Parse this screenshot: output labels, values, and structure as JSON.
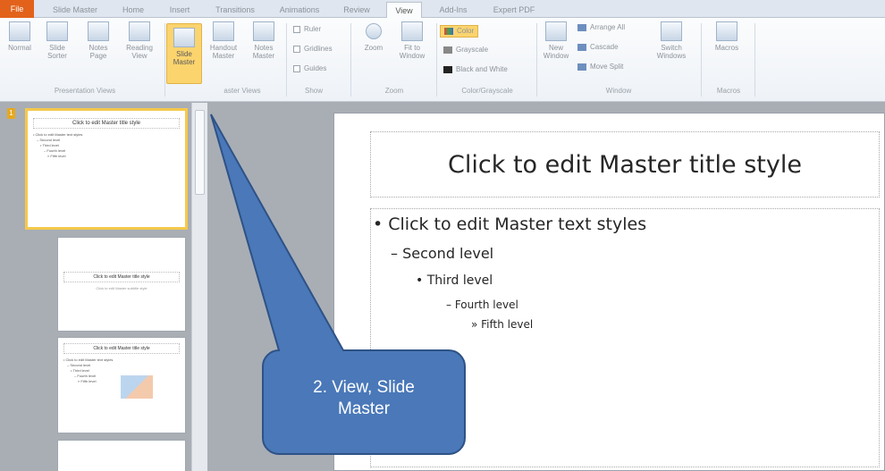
{
  "tabs": [
    "File",
    "Slide Master",
    "Home",
    "Insert",
    "Transitions",
    "Animations",
    "Review",
    "View",
    "Add-Ins",
    "Expert PDF"
  ],
  "active_tab": "View",
  "ribbon": {
    "normal": "Normal",
    "slide_sorter": [
      "Slide",
      "Sorter"
    ],
    "notes_page": [
      "Notes",
      "Page"
    ],
    "reading_view": [
      "Reading",
      "View"
    ],
    "slide_master": [
      "Slide",
      "Master"
    ],
    "handout_master": [
      "Handout",
      "Master"
    ],
    "notes_master": [
      "Notes",
      "Master"
    ],
    "ruler": "Ruler",
    "gridlines": "Gridlines",
    "guides": "Guides",
    "zoom": "Zoom",
    "fit_to_window": [
      "Fit to",
      "Window"
    ],
    "color": "Color",
    "grayscale": "Grayscale",
    "black_white": "Black and White",
    "new_window": [
      "New",
      "Window"
    ],
    "arrange_all": "Arrange All",
    "cascade": "Cascade",
    "move_split": "Move Split",
    "switch_windows": [
      "Switch",
      "Windows"
    ],
    "macros": "Macros",
    "groups": {
      "presentation_views": "Presentation Views",
      "master_views": "aster Views",
      "show": "Show",
      "zoom": "Zoom",
      "color_grayscale": "Color/Grayscale",
      "window": "Window",
      "macros": "Macros"
    },
    "colors": {
      "highlight": "#fbd46e",
      "file_tab": "#e2621b"
    }
  },
  "thumbnails": [
    {
      "num": "1",
      "title": "Click to edit Master title style",
      "lines": [
        "• Click to edit Master text styles",
        "– Second level",
        "• Third level",
        "– Fourth level",
        "» Fifth level"
      ]
    },
    {
      "title": "Click to edit Master title style",
      "subtitle": "Click to edit Master subtitle style"
    },
    {
      "title": "Click to edit Master title style",
      "lines": [
        "• Click to edit Master text styles",
        "– Second level",
        "• Third level",
        "– Fourth level",
        "» Fifth level"
      ]
    },
    {}
  ],
  "slide": {
    "title": "Click to edit Master title style",
    "levels": [
      "• Click to edit Master text styles",
      "– Second level",
      "• Third level",
      "– Fourth level",
      "» Fifth level"
    ]
  },
  "callout": {
    "line1": "2. View, Slide",
    "line2": "Master",
    "fill": "#4a78b8"
  }
}
